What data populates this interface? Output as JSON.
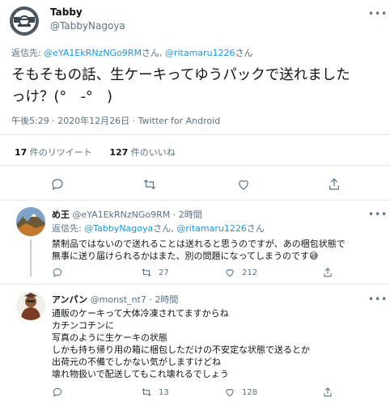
{
  "main_tweet": {
    "display_name": "Tabby",
    "handle": "@TabbyNagoya",
    "more_label": "•••",
    "reply_to_prefix": "返信先: ",
    "reply_to_user1": "@eYA1EkRNzNGo9RM",
    "reply_to_san1": "さん, ",
    "reply_to_user2": "@ritamaru1226",
    "reply_to_san2": "さん",
    "text_line1": "そもそもの話、生ケーキってゆうパックで送れまし",
    "text_line1b": "た",
    "text_line2": "っけ？(°　-°　)",
    "timestamp": "午後5:29 · 2020年12月26日 · Twitter for Android",
    "retweets_count": "17",
    "retweets_label": " 件のリツイート",
    "likes_count": "127",
    "likes_label": " 件のいいね"
  },
  "replies": [
    {
      "display_name": "め王",
      "handle": "@eYA1EkRNzNGo9RM",
      "time": " · 2時間",
      "reply_to_prefix": "返信先: ",
      "reply_to_user1": "@TabbyNagoya",
      "reply_to_san1": "さん, ",
      "reply_to_user2": "@ritamaru1226",
      "reply_to_san2": "さん",
      "text": [
        "禁制品ではないので送れることは送れると思うのですが、あの梱包状態で",
        "無事に送り届けられるかはまた、別の問題になってしまうのです😅"
      ],
      "retweets": "27",
      "likes": "212"
    },
    {
      "display_name": "アンパン",
      "handle": "@monst_nt7",
      "time": " · 2時間",
      "text": [
        "通販のケーキって大体冷凍されてますからね",
        "カチンコチンに",
        "写真のように生ケーキの状態",
        "しかも持ち帰り用の箱に梱包しただけの不安定な状態で送るとか",
        "出荷元の不備でしかない気がしますけどね",
        "壊れ物扱いで配送してもこれ壊れるでしょう"
      ],
      "retweets": "13",
      "likes": "128"
    }
  ],
  "icons": [
    "reply-icon",
    "retweet-icon",
    "like-icon",
    "share-icon",
    "more-icon"
  ],
  "colors": {
    "link": "#1b95e0",
    "secondary": "#5b7083",
    "divider": "#e1e8ed"
  }
}
